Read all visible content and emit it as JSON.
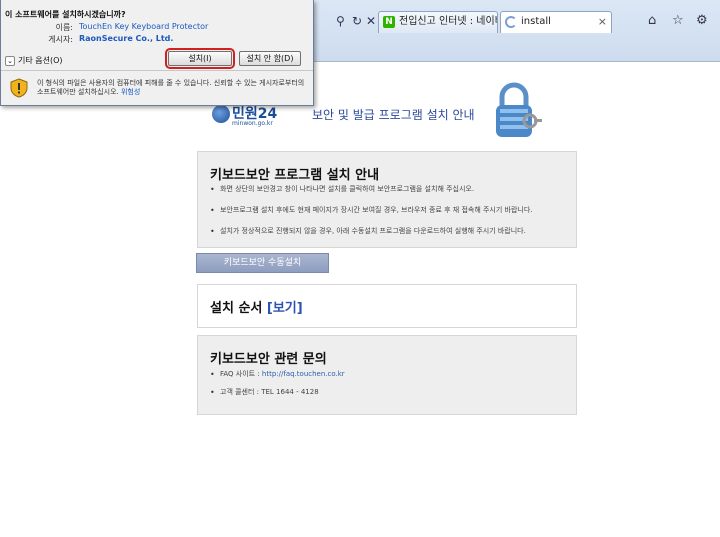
{
  "browser": {
    "tabs": [
      {
        "label": "전입신고 인터넷 : 네이버 통합..."
      },
      {
        "label": "install"
      }
    ],
    "tab_close": "×"
  },
  "page": {
    "logo_name": "민원24",
    "logo_sub": "minwon.go.kr",
    "header_title": "보안 및 발급 프로그램 설치 안내",
    "install_guide": {
      "heading": "키보드보안 프로그램 설치 안내",
      "items": [
        "화면 상단의 보안경고 창이 나타나면 설치를 클릭하여 보안프로그램을 설치해 주십시오.",
        "보안프로그램 설치 후에도 현재 페이지가 장시간 보여질 경우, 브라우저 종료 후 재 접속해 주시기 바랍니다.",
        "설치가 정상적으로 진행되지 않을 경우, 아래 수동설치 프로그램을 다운로드하여 실행해 주시기 바랍니다."
      ]
    },
    "manual_install_button": "키보드보안 수동설치",
    "install_order": {
      "heading": "설치 순서",
      "view_link": "[보기]"
    },
    "inquiry": {
      "heading": "키보드보안 관련 문의",
      "faq_label": "FAQ 사이트 : ",
      "faq_url": "http://faq.touchen.co.kr",
      "center": "고객 콜센터 : TEL 1644 - 4128"
    }
  },
  "dialog": {
    "question": "이 소프트웨어를 설치하시겠습니까?",
    "name_label": "이름:",
    "name_value": "TouchEn Key Keyboard Protector",
    "publisher_label": "게시자:",
    "publisher_value": "RaonSecure Co., Ltd.",
    "more_options": "기타 옵션(O)",
    "install_button": "설치(I)",
    "dont_install_button": "설치 안 함(D)",
    "warning_text": "이 형식의 파일은 사용자의 컴퓨터에 피해를 줄 수 있습니다. 신뢰할 수 있는 게시자로부터의 소프트웨어만 설치하십시오. ",
    "risk_link": "위험성"
  }
}
